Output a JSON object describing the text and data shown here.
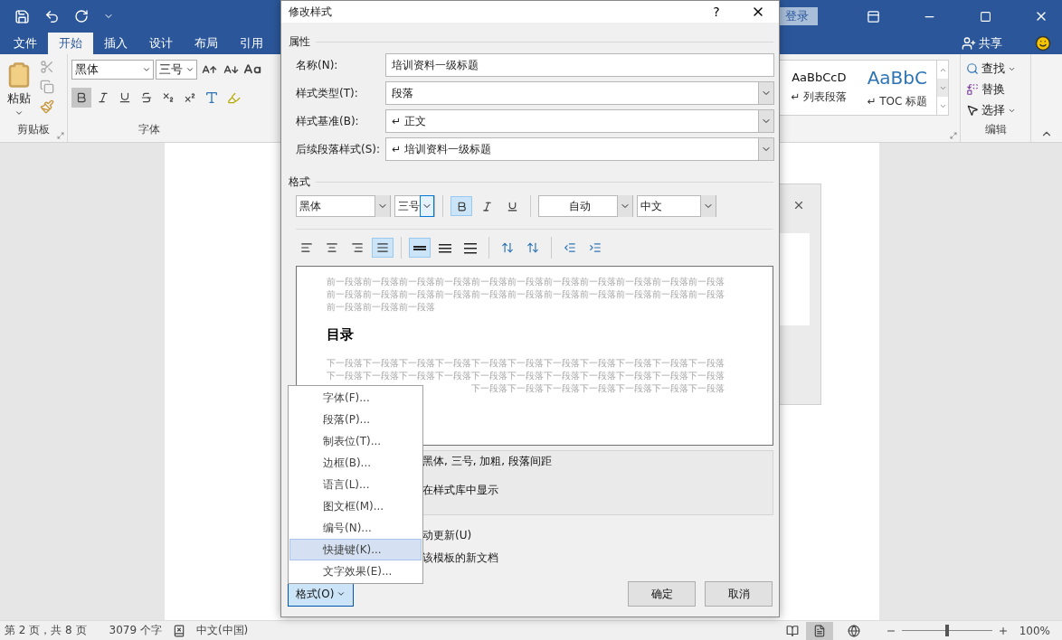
{
  "title_bar": {
    "login": "登录"
  },
  "tabs": [
    {
      "label": "文件",
      "selected": false
    },
    {
      "label": "开始",
      "selected": true
    },
    {
      "label": "插入",
      "selected": false
    },
    {
      "label": "设计",
      "selected": false
    },
    {
      "label": "布局",
      "selected": false
    },
    {
      "label": "引用",
      "selected": false
    }
  ],
  "share": "共享",
  "ribbon": {
    "clipboard": {
      "paste": "粘贴",
      "label": "剪贴板"
    },
    "font": {
      "name": "黑体",
      "size": "三号",
      "bold": true,
      "label": "字体"
    },
    "styles": [
      {
        "preview": "AaBbCcD",
        "name": "↵ 列表段落",
        "kind": "normal"
      },
      {
        "preview": "AaBbC",
        "name": "↵ TOC 标题",
        "kind": "heading"
      }
    ],
    "editing": {
      "find": "查找",
      "replace": "替换",
      "select": "选择",
      "label": "编辑"
    }
  },
  "dialog": {
    "title": "修改样式",
    "help": "?",
    "properties_heading": "属性",
    "fields": [
      {
        "label": "名称(N):",
        "value": "培训资料一级标题",
        "kind": "text"
      },
      {
        "label": "样式类型(T):",
        "value": "段落",
        "kind": "select"
      },
      {
        "label": "样式基准(B):",
        "value": "↵ 正文",
        "kind": "select"
      },
      {
        "label": "后续段落样式(S):",
        "value": "↵ 培训资料一级标题",
        "kind": "select"
      }
    ],
    "format_heading": "格式",
    "font": "黑体",
    "size": "三号",
    "bold": true,
    "italic": false,
    "underline": false,
    "color_select": "自动",
    "script": "中文",
    "alignment": [
      {
        "kind": "left",
        "selected": false
      },
      {
        "kind": "center",
        "selected": false
      },
      {
        "kind": "right",
        "selected": false
      },
      {
        "kind": "justify",
        "selected": true
      }
    ],
    "spacing": [
      {
        "kind": "single",
        "selected": true
      },
      {
        "kind": "one-half",
        "selected": false
      },
      {
        "kind": "double",
        "selected": false
      }
    ],
    "preview": {
      "before": [
        "前一段落前一段落前一段落前一段落前一段落前一段落前一段落前一段落前一段落前一段落前一段落",
        "前一段落前一段落前一段落前一段落前一段落前一段落前一段落前一段落前一段落前一段落前一段落",
        "前一段落前一段落前一段落"
      ],
      "heading": "目录",
      "after": [
        "下一段落下一段落下一段落下一段落下一段落下一段落下一段落下一段落下一段落下一段落下一段落",
        "下一段落下一段落下一段落下一段落下一段落下一段落下一段落下一段落下一段落下一段落下一段落",
        "下一段落下一段落下一段落下一段落下一段落下一段落下一段落"
      ]
    },
    "description": [
      "黑体, 三号, 加粗, 段落间距",
      "在样式库中显示"
    ],
    "options": [
      "动更新(U)",
      "该模板的新文档"
    ],
    "format_button": {
      "label": "格式(O)",
      "expanded": true
    },
    "buttons": [
      "确定",
      "取消"
    ],
    "menu": [
      {
        "label": "字体(F)...",
        "selected": false
      },
      {
        "label": "段落(P)...",
        "selected": false
      },
      {
        "label": "制表位(T)...",
        "selected": false
      },
      {
        "label": "边框(B)...",
        "selected": false
      },
      {
        "label": "语言(L)...",
        "selected": false
      },
      {
        "label": "图文框(M)...",
        "selected": false
      },
      {
        "label": "编号(N)...",
        "selected": false
      },
      {
        "label": "快捷键(K)...",
        "selected": true
      },
      {
        "label": "文字效果(E)...",
        "selected": false
      }
    ]
  },
  "status_bar": {
    "page": "第 2 页，共 8 页",
    "words": "3079 个字",
    "language": "中文(中国)",
    "views": [
      {
        "kind": "read",
        "selected": false
      },
      {
        "kind": "print",
        "selected": true
      },
      {
        "kind": "web",
        "selected": false
      }
    ],
    "zoom": {
      "level": 0.5,
      "label": "100%"
    }
  }
}
